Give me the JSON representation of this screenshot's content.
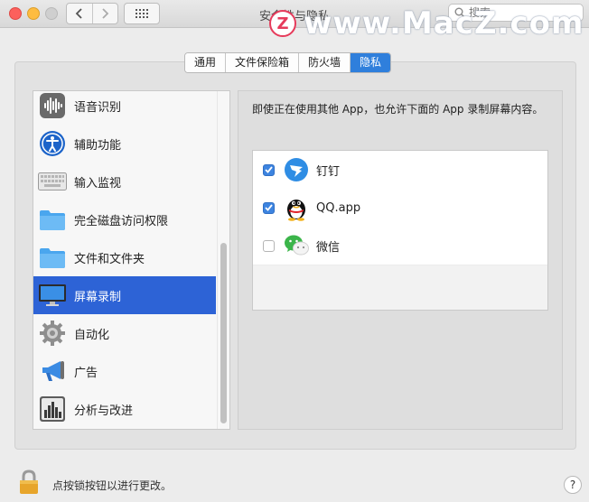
{
  "window": {
    "title": "安全性与隐私",
    "search_placeholder": "搜索",
    "watermark_badge": "Z",
    "watermark_text": "www.MacZ.com"
  },
  "tabs": [
    {
      "label": "通用",
      "active": false
    },
    {
      "label": "文件保险箱",
      "active": false
    },
    {
      "label": "防火墙",
      "active": false
    },
    {
      "label": "隐私",
      "active": true
    }
  ],
  "sidebar": {
    "items": [
      {
        "label": "语音识别",
        "icon": "speech-recognition-icon",
        "selected": false
      },
      {
        "label": "辅助功能",
        "icon": "accessibility-icon",
        "selected": false
      },
      {
        "label": "输入监视",
        "icon": "keyboard-icon",
        "selected": false
      },
      {
        "label": "完全磁盘访问权限",
        "icon": "folder-icon",
        "selected": false
      },
      {
        "label": "文件和文件夹",
        "icon": "folder-icon",
        "selected": false
      },
      {
        "label": "屏幕录制",
        "icon": "display-icon",
        "selected": true
      },
      {
        "label": "自动化",
        "icon": "gear-icon",
        "selected": false
      },
      {
        "label": "广告",
        "icon": "megaphone-icon",
        "selected": false
      },
      {
        "label": "分析与改进",
        "icon": "bar-chart-icon",
        "selected": false
      }
    ]
  },
  "content": {
    "description": "即使正在使用其他 App，也允许下面的 App 录制屏幕内容。",
    "apps": [
      {
        "name": "钉钉",
        "checked": true,
        "icon": "dingtalk-icon"
      },
      {
        "name": "QQ.app",
        "checked": true,
        "icon": "qq-penguin-icon"
      },
      {
        "name": "微信",
        "checked": false,
        "icon": "wechat-icon"
      }
    ]
  },
  "footer": {
    "lock_text": "点按锁按钮以进行更改。",
    "help_label": "?"
  },
  "colors": {
    "accent": "#2f7fdc",
    "selection": "#2d63d6",
    "checkbox_on": "#3d84e0"
  }
}
